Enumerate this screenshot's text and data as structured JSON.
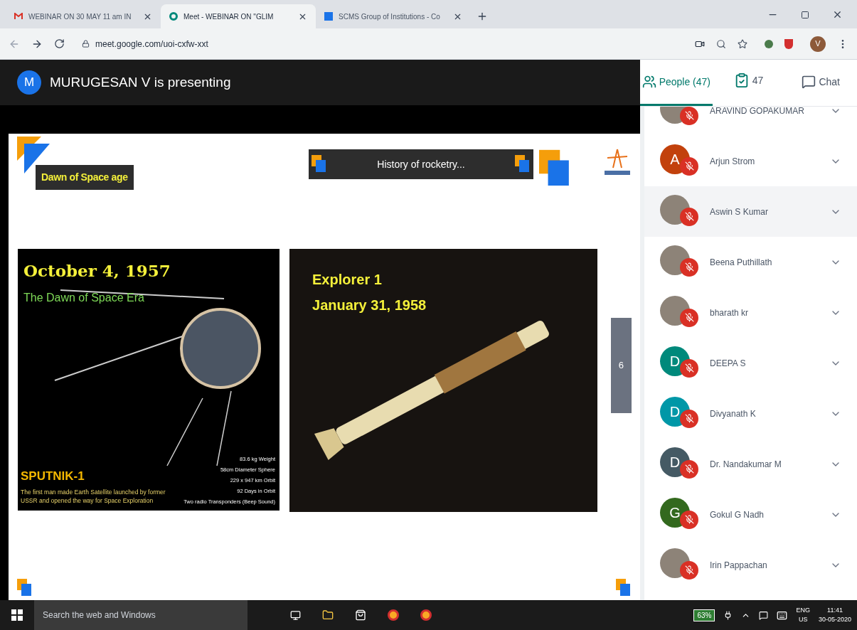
{
  "browser": {
    "tabs": [
      {
        "title": "WEBINAR ON 30 MAY 11 am IN",
        "kind": "gmail",
        "selected": false
      },
      {
        "title": "Meet - WEBINAR ON \"GLIM",
        "kind": "meet",
        "selected": true
      },
      {
        "title": "SCMS Group of Institutions - Co",
        "kind": "site",
        "selected": false
      }
    ],
    "url": "meet.google.com/uoi-cxfw-xxt",
    "profile_initial": "V"
  },
  "presenter": {
    "initial": "M",
    "text": "MURUGESAN V is presenting"
  },
  "slide": {
    "label": "Dawn of Space age",
    "title": "History of rocketry...",
    "page": "6",
    "left_panel": {
      "date": "October 4, 1957",
      "subtitle": "The Dawn of Space Era",
      "name": "SPUTNIK-1",
      "description": "The first man made Earth Satellite launched by former USSR and opened the way for Space Exploration",
      "specs": [
        "83.6 kg Weight",
        "58cm Diameter Sphere",
        "229 x 947 km Orbit",
        "92 Days in Orbit",
        "Two radio Transponders (Beep Sound)"
      ]
    },
    "right_panel": {
      "name": "Explorer 1",
      "date": "January 31, 1958"
    }
  },
  "side_tabs": [
    {
      "label": "People (47)",
      "kind": "people",
      "selected": true
    },
    {
      "label": "47",
      "kind": "tasks",
      "selected": false
    },
    {
      "label": "Chat",
      "kind": "chat",
      "selected": false
    }
  ],
  "people": [
    {
      "name": "ARAVIND GOPAKUMAR",
      "kind": "photo",
      "hovered": false
    },
    {
      "name": "Arjun Strom",
      "kind": "letter",
      "initial": "A",
      "color": "#c2410c",
      "hovered": false
    },
    {
      "name": "Aswin S Kumar",
      "kind": "photo",
      "hovered": true
    },
    {
      "name": "Beena Puthillath",
      "kind": "photo",
      "hovered": false
    },
    {
      "name": "bharath kr",
      "kind": "photo",
      "hovered": false
    },
    {
      "name": "DEEPA S",
      "kind": "letter",
      "initial": "D",
      "color": "#00897b",
      "hovered": false
    },
    {
      "name": "Divyanath K",
      "kind": "letter",
      "initial": "D",
      "color": "#0097a7",
      "hovered": false
    },
    {
      "name": "Dr. Nandakumar M",
      "kind": "letter",
      "initial": "D",
      "color": "#455a64",
      "hovered": false
    },
    {
      "name": "Gokul G Nadh",
      "kind": "letter",
      "initial": "G",
      "color": "#33691e",
      "hovered": false
    },
    {
      "name": "Irin Pappachan",
      "kind": "photo",
      "hovered": false
    }
  ],
  "taskbar": {
    "search_placeholder": "Search the web and Windows",
    "battery": "63%",
    "language": "ENG",
    "region": "US",
    "time": "11:41",
    "date": "30-05-2020"
  }
}
